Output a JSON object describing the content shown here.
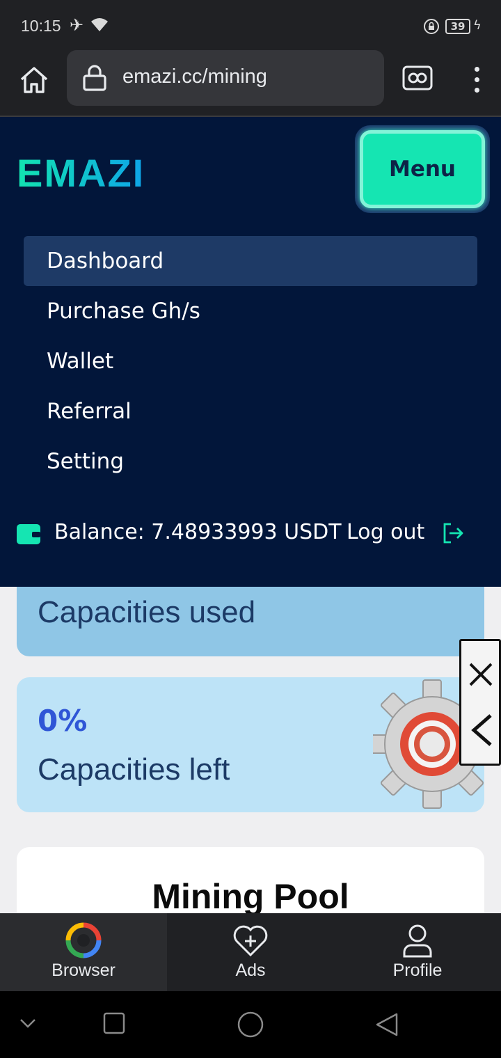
{
  "status_bar": {
    "time": "10:15",
    "battery": "39"
  },
  "browser": {
    "url": "emazi.cc/mining"
  },
  "site": {
    "logo": "EMAZI",
    "menu_button": "Menu",
    "nav": [
      {
        "label": "Dashboard",
        "active": true
      },
      {
        "label": "Purchase Gh/s",
        "active": false
      },
      {
        "label": "Wallet",
        "active": false
      },
      {
        "label": "Referral",
        "active": false
      },
      {
        "label": "Setting",
        "active": false
      }
    ],
    "balance": "Balance: 7.48933993 USDT",
    "logout": "Log out"
  },
  "content": {
    "capacities_used_label": "Capacities used",
    "capacities_left_percent": "0%",
    "capacities_left_label": "Capacities left",
    "mining_pool_title": "Mining Pool"
  },
  "bottom_nav": [
    {
      "label": "Browser",
      "active": true
    },
    {
      "label": "Ads",
      "active": false
    },
    {
      "label": "Profile",
      "active": false
    }
  ],
  "colors": {
    "header_bg": "#02163a",
    "accent": "#15e5b2",
    "active_nav_bg": "#1e3a66",
    "card_used_bg": "#8fc6e6",
    "card_left_bg": "#bde3f7"
  }
}
